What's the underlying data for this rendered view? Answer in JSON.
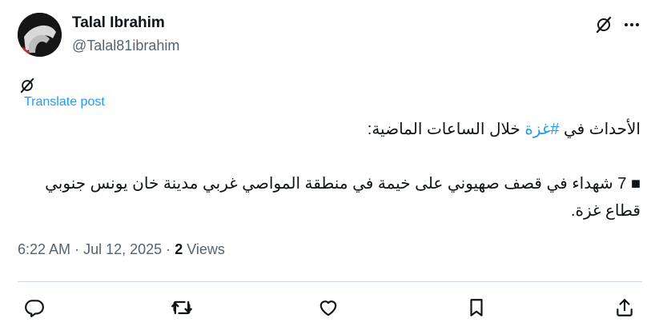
{
  "author": {
    "name": "Talal Ibrahim",
    "handle": "@Talal81ibrahim"
  },
  "translate_label": "Translate post",
  "tweet": {
    "line1_prefix": "الأحداث في ",
    "hashtag": "#غزة",
    "line1_suffix": " خلال الساعات الماضية:",
    "line2": "■ 7 شهداء في قصف صهيوني على خيمة في منطقة المواصي غربي مدينة خان يونس جنوبي قطاع غزة."
  },
  "meta": {
    "time": "6:22 AM",
    "sep1": "·",
    "date": "Jul 12, 2025",
    "sep2": "·",
    "views_count": "2",
    "views_label": "Views"
  },
  "icons": {
    "grok": "grok-icon",
    "more": "more-icon",
    "reply": "reply-icon",
    "retweet": "retweet-icon",
    "like": "heart-icon",
    "bookmark": "bookmark-icon",
    "share": "share-icon"
  },
  "colors": {
    "text": "#0f1419",
    "secondary": "#536471",
    "link": "#1d9bf0",
    "divider": "#cfd9de"
  }
}
